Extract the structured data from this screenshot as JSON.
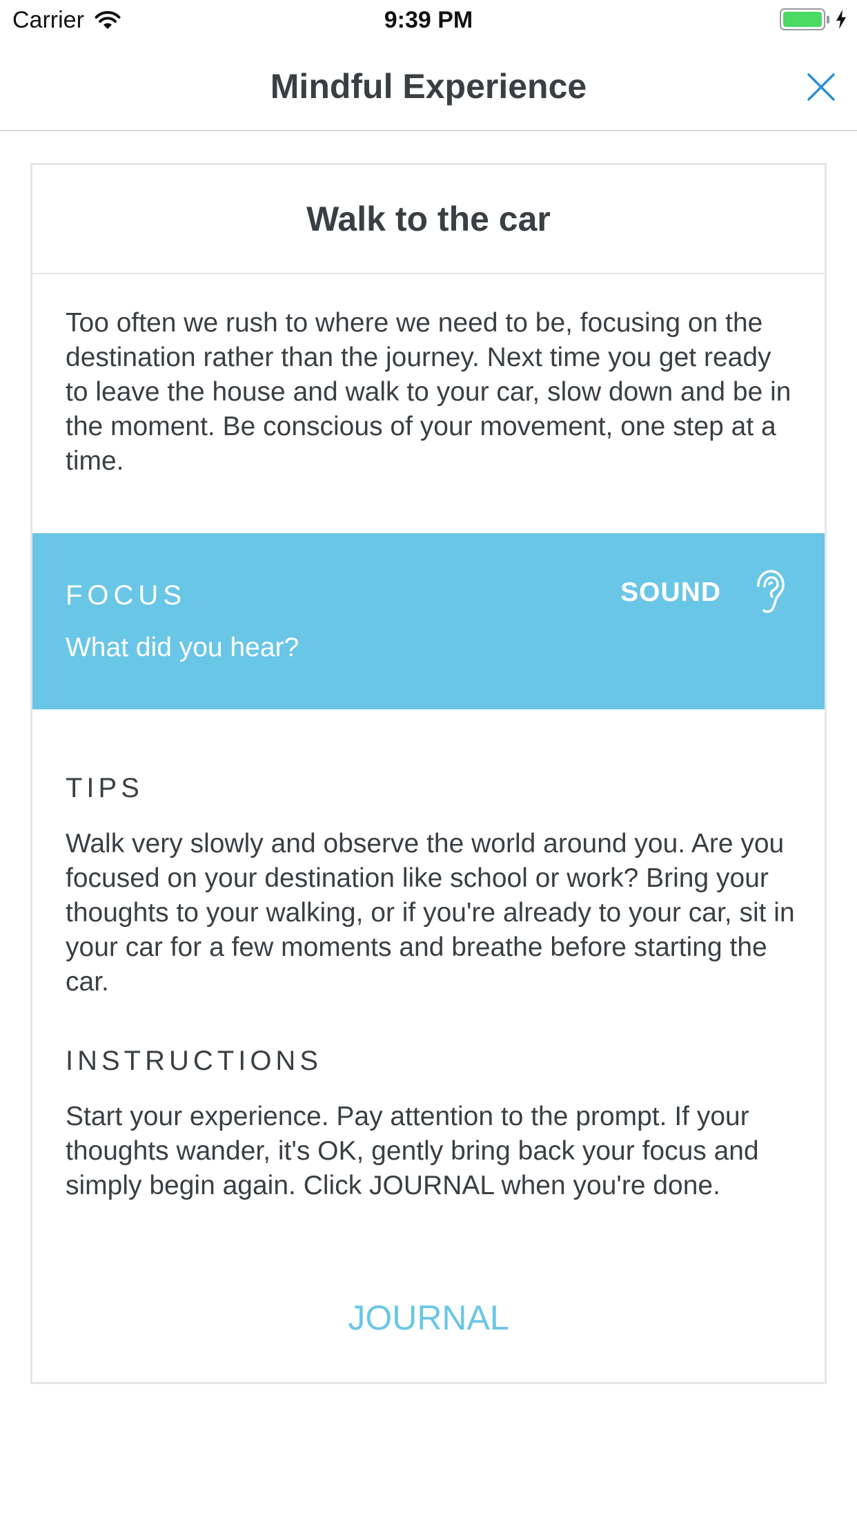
{
  "status_bar": {
    "carrier": "Carrier",
    "time": "9:39 PM"
  },
  "nav": {
    "title": "Mindful Experience",
    "close_icon": "close-icon"
  },
  "card": {
    "title": "Walk to the car",
    "intro": "Too often we rush to where we need to be, focusing on the destination rather than the journey. Next time you get ready to leave the house and walk to your car, slow down and be in the moment. Be conscious of your movement, one step at a time.",
    "focus": {
      "label": "FOCUS",
      "prompt": "What did you hear?",
      "sense": "SOUND",
      "sense_icon": "ear-icon"
    },
    "tips": {
      "heading": "TIPS",
      "text": "Walk very slowly and observe the world around you. Are you focused on your destination like school or work? Bring your thoughts to your walking, or if you're already to your car, sit in your car for a few moments and breathe before starting the car."
    },
    "instructions": {
      "heading": "INSTRUCTIONS",
      "text": "Start your experience. Pay attention to the prompt. If your thoughts wander, it's OK, gently bring back your focus and simply begin again. Click JOURNAL when you're done."
    },
    "journal_label": "JOURNAL"
  },
  "colors": {
    "accent": "#6ac6e6",
    "text": "#3a3f44",
    "close_icon": "#2a8fd6",
    "battery": "#4cd964"
  }
}
